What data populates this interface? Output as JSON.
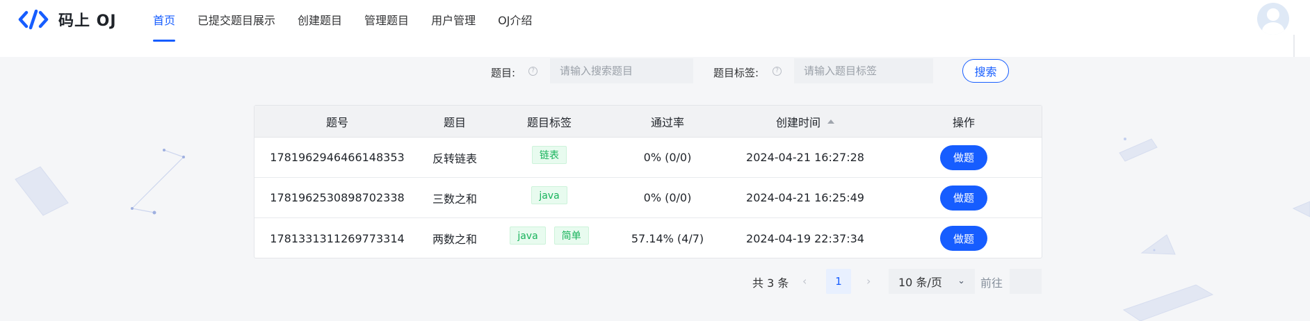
{
  "brand": {
    "name": "码上 OJ",
    "logo_icon": "code-brackets-icon",
    "accent": "#165dff"
  },
  "nav": {
    "items": [
      {
        "label": "首页",
        "active": true
      },
      {
        "label": "已提交题目展示",
        "active": false
      },
      {
        "label": "创建题目",
        "active": false
      },
      {
        "label": "管理题目",
        "active": false
      },
      {
        "label": "用户管理",
        "active": false
      },
      {
        "label": "OJ介绍",
        "active": false
      }
    ]
  },
  "user": {
    "avatar_icon": "default-avatar-icon"
  },
  "search": {
    "title_label": "题目:",
    "title_placeholder": "请输入搜索题目",
    "title_value": "",
    "tags_label": "题目标签:",
    "tags_placeholder": "请输入题目标签",
    "tags_value": "",
    "button_label": "搜索"
  },
  "table": {
    "columns": [
      "题号",
      "题目",
      "题目标签",
      "通过率",
      "创建时间",
      "操作"
    ],
    "sorted_column": "创建时间",
    "rows": [
      {
        "id": "1781962946466148353",
        "title": "反转链表",
        "tags": [
          "链表"
        ],
        "pass_rate": "0% (0/0)",
        "created": "2024-04-21 16:27:28",
        "action": "做题"
      },
      {
        "id": "1781962530898702338",
        "title": "三数之和",
        "tags": [
          "java"
        ],
        "pass_rate": "0% (0/0)",
        "created": "2024-04-21 16:25:49",
        "action": "做题"
      },
      {
        "id": "1781331311269773314",
        "title": "两数之和",
        "tags": [
          "java",
          "简单"
        ],
        "pass_rate": "57.14% (4/7)",
        "created": "2024-04-19 22:37:34",
        "action": "做题"
      }
    ]
  },
  "pagination": {
    "total_text": "共 3 条",
    "prev_icon": "chevron-left-icon",
    "current_page": "1",
    "next_icon": "chevron-right-icon",
    "page_size": "10 条/页",
    "goto_label": "前往",
    "goto_value": ""
  },
  "colors": {
    "tag_bg": "#e8fbef",
    "tag_text": "#18b35b",
    "primary": "#165dff",
    "page_bg": "#f5f6f8"
  }
}
